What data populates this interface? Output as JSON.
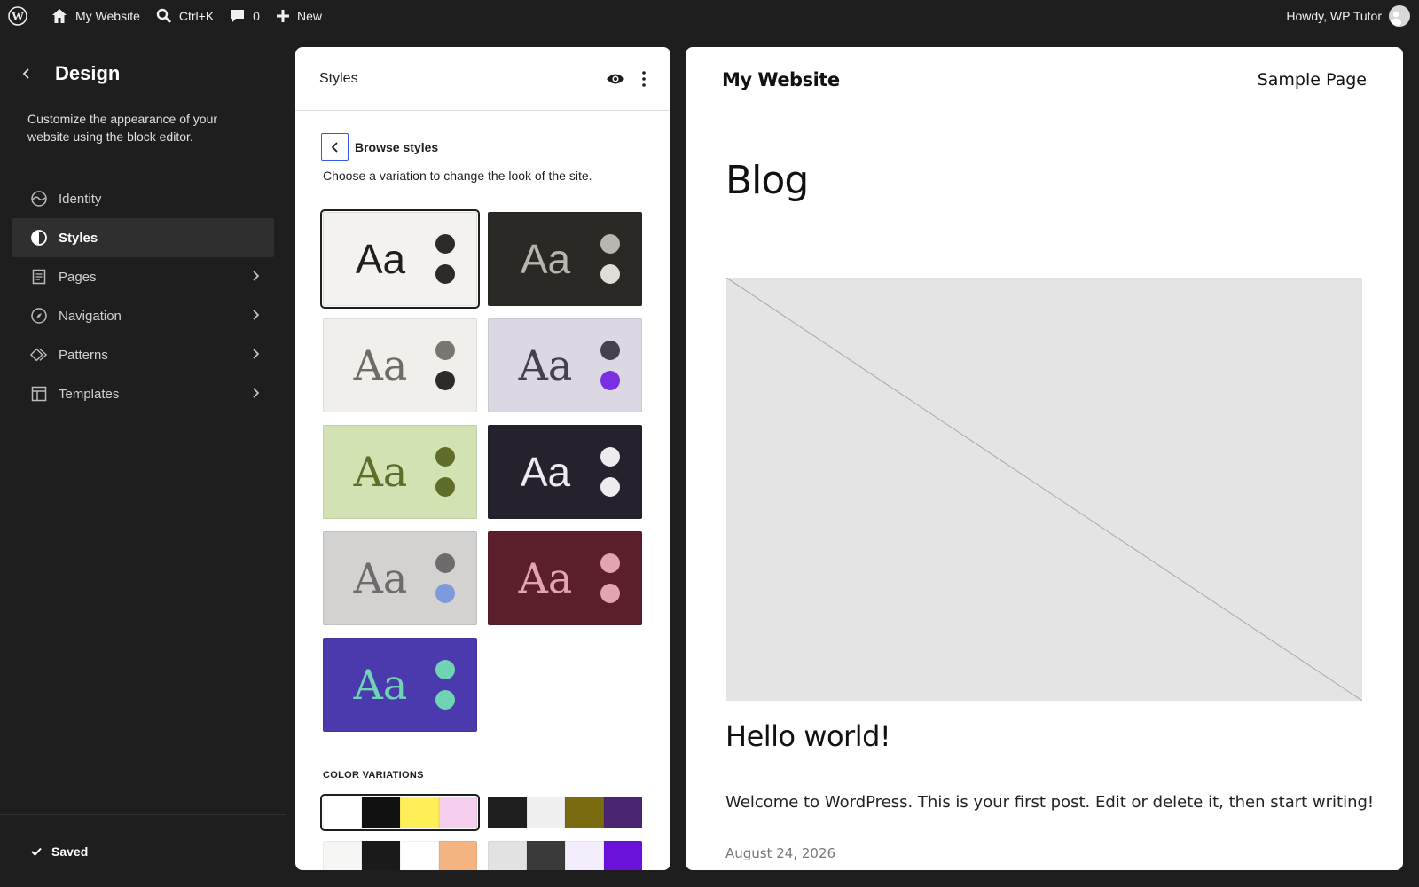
{
  "adminbar": {
    "site_name": "My Website",
    "search_shortcut": "Ctrl+K",
    "comments_count": "0",
    "new_label": "New",
    "greeting": "Howdy, WP Tutor"
  },
  "sidebar": {
    "title": "Design",
    "description": "Customize the appearance of your website using the block editor.",
    "items": [
      {
        "label": "Identity"
      },
      {
        "label": "Styles"
      },
      {
        "label": "Pages"
      },
      {
        "label": "Navigation"
      },
      {
        "label": "Patterns"
      },
      {
        "label": "Templates"
      }
    ],
    "saved_label": "Saved"
  },
  "styles_panel": {
    "title": "Styles",
    "browse_title": "Browse styles",
    "browse_description": "Choose a variation to change the look of the site.",
    "variations": [
      {
        "aa": "Aa",
        "bg": "#f4f2ee",
        "text": "#1e1e1e",
        "dots": [
          "#2d2a27",
          "#2d2a27"
        ]
      },
      {
        "aa": "Aa",
        "bg": "#2b2926",
        "text": "#b9b6b1",
        "dots": [
          "#b9b6b1",
          "#e0ddd8"
        ]
      },
      {
        "aa": "Aa",
        "bg": "#f1efeb",
        "text": "#6f6b67",
        "dots": [
          "#7a7672",
          "#2d2a27"
        ]
      },
      {
        "aa": "Aa",
        "bg": "#dcd8e3",
        "text": "#45404f",
        "dots": [
          "#45404f",
          "#7b2fe0"
        ]
      },
      {
        "aa": "Aa",
        "bg": "#d3e2b3",
        "text": "#5e6e2a",
        "dots": [
          "#5e6e2a",
          "#5e6e2a"
        ]
      },
      {
        "aa": "Aa",
        "bg": "#26222d",
        "text": "#efe9f0",
        "dots": [
          "#efe9f0",
          "#efe9f0"
        ]
      },
      {
        "aa": "Aa",
        "bg": "#d4d2d1",
        "text": "#6d6b6b",
        "dots": [
          "#6d6b6b",
          "#7d9bdc"
        ]
      },
      {
        "aa": "Aa",
        "bg": "#5a1f2b",
        "text": "#e4a3b3",
        "dots": [
          "#e4a3b3",
          "#e4a3b3"
        ]
      },
      {
        "aa": "Aa",
        "bg": "#4a3aae",
        "text": "#6fd3b4",
        "dots": [
          "#6fd3b4",
          "#6fd3b4"
        ]
      }
    ],
    "color_variations_label": "COLOR VARIATIONS",
    "color_variations": [
      [
        "#ffffff",
        "#111111",
        "#ffee58",
        "#f6cfef"
      ],
      [
        "#1e1e1e",
        "#f0f0f0",
        "#7a6a10",
        "#4b2570"
      ],
      [
        "#f6f6f4",
        "#1a1a1a",
        "#ffffff",
        "#f4b482"
      ],
      [
        "#e2e2e2",
        "#3a3a3a",
        "#f4eefc",
        "#6a12d9"
      ]
    ]
  },
  "preview": {
    "site_title": "My Website",
    "nav_link": "Sample Page",
    "page_title": "Blog",
    "post_title": "Hello world!",
    "post_excerpt": "Welcome to WordPress. This is your first post. Edit or delete it, then start writing!",
    "post_date": "August 24, 2026"
  }
}
